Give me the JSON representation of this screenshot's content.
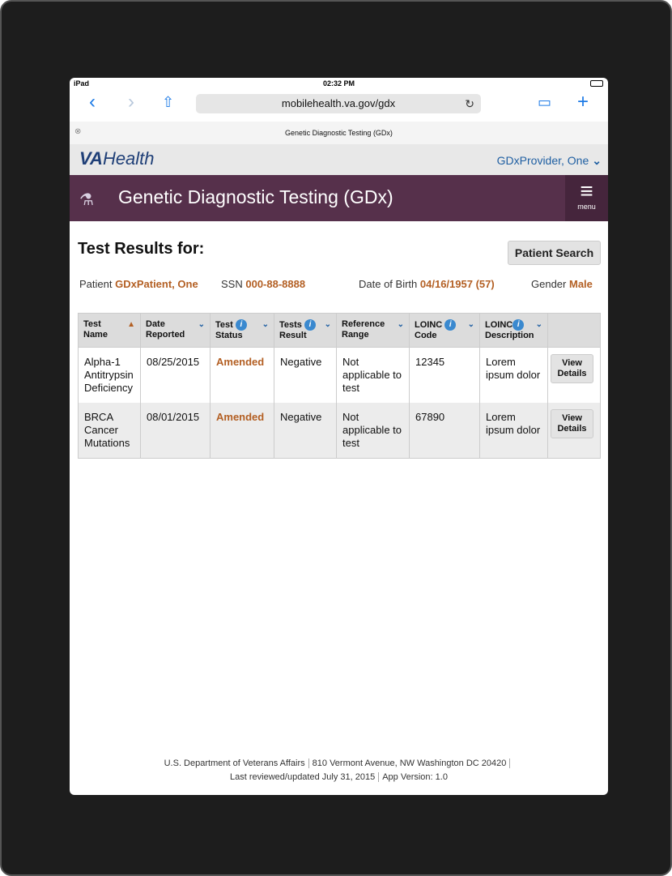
{
  "statusbar": {
    "device": "iPad",
    "time": "02:32 PM"
  },
  "browser": {
    "url": "mobilehealth.va.gov/gdx",
    "tab_title": "Genetic Diagnostic Testing (GDx)"
  },
  "header": {
    "logo_va": "VA",
    "logo_health": "Health",
    "provider": "GDxProvider, One"
  },
  "appbar": {
    "title": "Genetic Diagnostic Testing (GDx)",
    "menu_label": "menu"
  },
  "page": {
    "heading": "Test Results for:",
    "patient_search": "Patient Search"
  },
  "patient": {
    "patient_label": "Patient",
    "patient_name": "GDxPatient, One",
    "ssn_label": "SSN",
    "ssn": "000-88-8888",
    "dob_label": "Date of Birth",
    "dob": "04/16/1957 (57)",
    "gender_label": "Gender",
    "gender": "Male"
  },
  "table": {
    "headers": [
      "Test Name",
      "Date Reported",
      "Test Status",
      "Tests Result",
      "Reference Range",
      "LOINC Code",
      "LOINC Description"
    ],
    "headers_line1": [
      "Test",
      "Date",
      "Test",
      "Tests",
      "Reference",
      "LOINC",
      "LOINC"
    ],
    "headers_line2": [
      "Name",
      "Reported",
      "Status",
      "Result",
      "Range",
      "Code",
      "Description"
    ],
    "rows": [
      {
        "name": "Alpha-1 Antitrypsin Deficiency",
        "date": "08/25/2015",
        "status": "Amended",
        "result": "Negative",
        "range": "Not applicable to test",
        "code": "12345",
        "desc": "Lorem ipsum dolor",
        "action": "View Details"
      },
      {
        "name": "BRCA Cancer Mutations",
        "date": "08/01/2015",
        "status": "Amended",
        "result": "Negative",
        "range": "Not applicable to test",
        "code": "67890",
        "desc": "Lorem ipsum dolor",
        "action": "View Details"
      }
    ]
  },
  "footer": {
    "org": "U.S. Department of Veterans Affairs",
    "address": "810 Vermont Avenue, NW Washington DC 20420",
    "updated": "Last reviewed/updated July 31, 2015",
    "version": "App Version: 1.0"
  },
  "colors": {
    "accent_orange": "#b35f23",
    "brand_purple": "#56304b",
    "link_blue": "#1f5fa2"
  }
}
